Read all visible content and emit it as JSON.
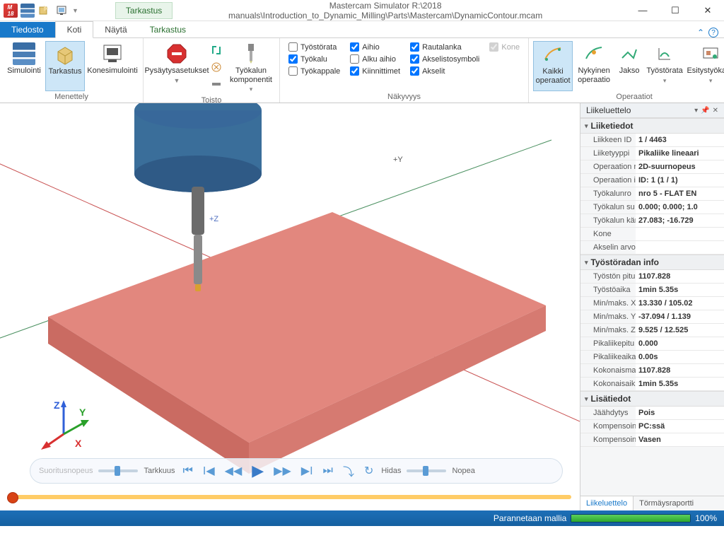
{
  "titlebar": {
    "context_tab": "Tarkastus",
    "app_title": "Mastercam Simulator  R:\\2018 manuals\\Introduction_to_Dynamic_Milling\\Parts\\Mastercam\\DynamicContour.mcam"
  },
  "ribbon_tabs": {
    "file": "Tiedosto",
    "home": "Koti",
    "view": "Näytä",
    "context": "Tarkastus"
  },
  "ribbon": {
    "menettely": {
      "label": "Menettely",
      "simulointi": "Simulointi",
      "tarkastus": "Tarkastus",
      "konesimulointi": "Konesimulointi"
    },
    "toisto": {
      "label": "Toisto",
      "pysaytysasetukset": "Pysäytysasetukset",
      "tyokalun_komponentit": "Työkalun komponentit"
    },
    "nakyvyys": {
      "label": "Näkyvyys",
      "tyostorata": "Työstörata",
      "tyokalu": "Työkalu",
      "tyokappale": "Työkappale",
      "aihio": "Aihio",
      "alku_aihio": "Alku aihio",
      "kiinnittimet": "Kiinnittimet",
      "rautalanka": "Rautalanka",
      "akselistosymboli": "Akselistosymboli",
      "akselit": "Akselit",
      "kone": "Kone"
    },
    "operaatiot": {
      "label": "Operaatiot",
      "kaikki": "Kaikki operaatiot",
      "nykyinen": "Nykyinen operaatio",
      "jakso": "Jakso",
      "tyostorata": "Työstörata",
      "esitystyokalut": "Esitystyökalut"
    }
  },
  "playback": {
    "suoritusnopeus": "Suoritusnopeus",
    "tarkkuus": "Tarkkuus",
    "hidas": "Hidas",
    "nopea": "Nopea"
  },
  "viewport": {
    "y_axis": "+Y",
    "z_axis": "+Z",
    "triad_x": "X",
    "triad_y": "Y",
    "triad_z": "Z"
  },
  "panel": {
    "title": "Liikeluettelo",
    "sections": {
      "liiketiedot": "Liiketiedot",
      "tyostoradan_info": "Työstöradan info",
      "lisatiedot": "Lisätiedot"
    },
    "props": {
      "liikkeen_id": {
        "k": "Liikkeen ID",
        "v": "1 / 4463"
      },
      "liiketyyppi": {
        "k": "Liiketyyppi",
        "v": "Pikaliike lineaari"
      },
      "operaation_n": {
        "k": "Operaation n",
        "v": "2D-suurnopeus"
      },
      "operaation_id": {
        "k": "Operaation i",
        "v": "ID: 1 (1 / 1)"
      },
      "tyokalunro": {
        "k": "Työkalunro",
        "v": "nro 5 - FLAT EN"
      },
      "tyokalun_su": {
        "k": "Työkalun su",
        "v": "0.000; 0.000; 1.0"
      },
      "tyokalun_kar": {
        "k": "Työkalun kär",
        "v": "27.083; -16.729"
      },
      "kone": {
        "k": "Kone",
        "v": ""
      },
      "akselin_arvo": {
        "k": "Akselin arvo",
        "v": ""
      },
      "tyoston_pitu": {
        "k": "Työstön pitu",
        "v": "1107.828"
      },
      "tyostoaika": {
        "k": "Työstöaika",
        "v": "1min 5.35s"
      },
      "minmaks_x": {
        "k": "Min/maks. X",
        "v": "13.330 / 105.02"
      },
      "minmaks_y": {
        "k": "Min/maks. Y",
        "v": "-37.094 / 1.139"
      },
      "minmaks_z": {
        "k": "Min/maks. Z",
        "v": "9.525 / 12.525"
      },
      "pikaliikepitu": {
        "k": "Pikaliikepitu",
        "v": "0.000"
      },
      "pikaliikeaika": {
        "k": "Pikaliikeaika",
        "v": "0.00s"
      },
      "kokonaisma": {
        "k": "Kokonaisma",
        "v": "1107.828"
      },
      "kokonaisaik": {
        "k": "Kokonaisaik",
        "v": "1min 5.35s"
      },
      "jaahdytys": {
        "k": "Jäähdytys",
        "v": "Pois"
      },
      "kompensoin1": {
        "k": "Kompensoin",
        "v": "PC:ssä"
      },
      "kompensoin2": {
        "k": "Kompensoin",
        "v": "Vasen"
      }
    },
    "tabs": {
      "liikeluettelo": "Liikeluettelo",
      "tormaysraportti": "Törmäysraportti"
    }
  },
  "statusbar": {
    "label": "Parannetaan mallia",
    "percent": "100%"
  }
}
